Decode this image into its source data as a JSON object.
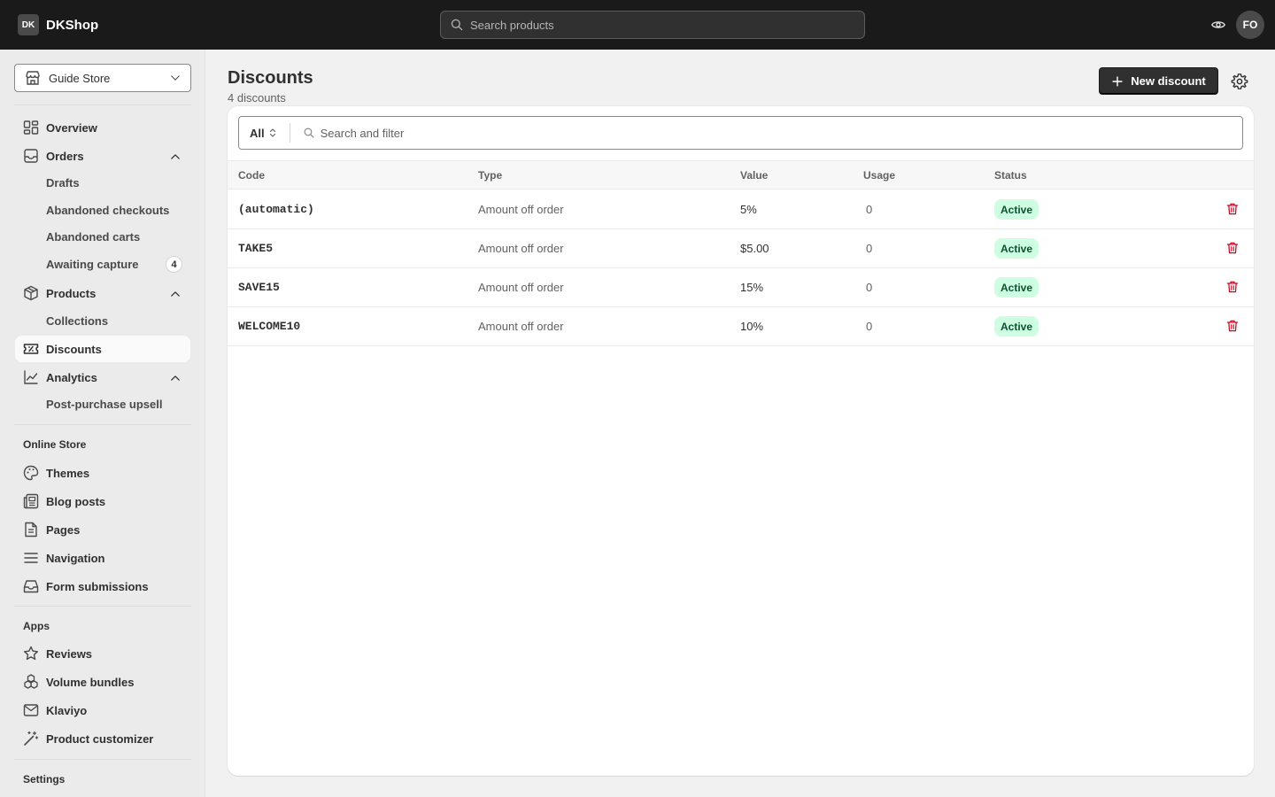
{
  "topbar": {
    "brand_mark": "DK",
    "brand_name": "DKShop",
    "search_placeholder": "Search products",
    "preview_icon": "eye-icon",
    "avatar_initials": "FO"
  },
  "sidebar": {
    "store_name": "Guide Store",
    "items": {
      "overview": "Overview",
      "orders": "Orders",
      "drafts": "Drafts",
      "abandoned_checkouts": "Abandoned checkouts",
      "abandoned_carts": "Abandoned carts",
      "awaiting_capture": "Awaiting capture",
      "awaiting_capture_count": "4",
      "products": "Products",
      "collections": "Collections",
      "discounts": "Discounts",
      "analytics": "Analytics",
      "post_purchase_upsell": "Post-purchase upsell"
    },
    "online_store": {
      "heading": "Online Store",
      "themes": "Themes",
      "blog_posts": "Blog posts",
      "pages": "Pages",
      "navigation": "Navigation",
      "form_submissions": "Form submissions"
    },
    "apps": {
      "heading": "Apps",
      "reviews": "Reviews",
      "volume_bundles": "Volume bundles",
      "klaviyo": "Klaviyo",
      "product_customizer": "Product customizer"
    },
    "settings_heading": "Settings",
    "active_item": "Discounts"
  },
  "main": {
    "title": "Discounts",
    "subtitle": "4 discounts",
    "new_button": "New discount",
    "filter": {
      "selected": "All",
      "search_placeholder": "Search and filter"
    },
    "columns": {
      "code": "Code",
      "type": "Type",
      "value": "Value",
      "usage": "Usage",
      "status": "Status"
    },
    "rows": [
      {
        "code": "(automatic)",
        "type": "Amount off order",
        "value": "5%",
        "usage": "0",
        "status": "Active"
      },
      {
        "code": "TAKE5",
        "type": "Amount off order",
        "value": "$5.00",
        "usage": "0",
        "status": "Active"
      },
      {
        "code": "SAVE15",
        "type": "Amount off order",
        "value": "15%",
        "usage": "0",
        "status": "Active"
      },
      {
        "code": "WELCOME10",
        "type": "Amount off order",
        "value": "10%",
        "usage": "0",
        "status": "Active"
      }
    ]
  },
  "colors": {
    "topbar": "#1a1a1a",
    "primary_button": "#303030",
    "status_active_bg": "#cdfee1",
    "status_active_text": "#0c5132",
    "delete_icon": "#c70a24"
  }
}
